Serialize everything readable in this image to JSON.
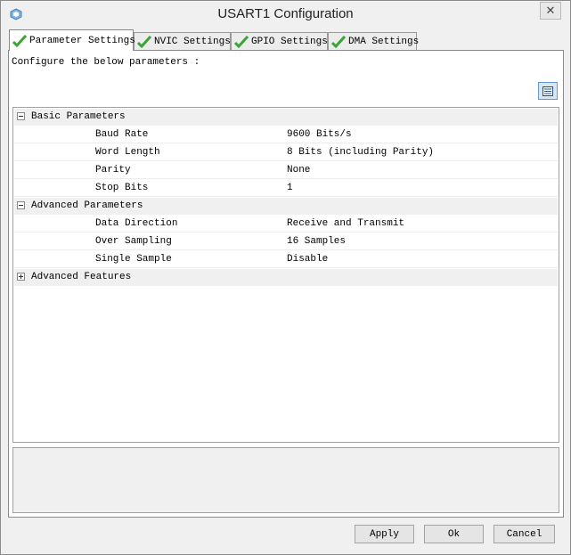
{
  "window": {
    "title": "USART1 Configuration",
    "close_glyph": "✕"
  },
  "tabs": [
    {
      "label": "Parameter Settings",
      "active": true
    },
    {
      "label": "NVIC Settings",
      "active": false
    },
    {
      "label": "GPIO Settings",
      "active": false
    },
    {
      "label": "DMA Settings",
      "active": false
    }
  ],
  "intro": "Configure the below parameters :",
  "groups": [
    {
      "label": "Basic Parameters",
      "expanded": true,
      "items": [
        {
          "name": "Baud Rate",
          "value": "9600 Bits/s"
        },
        {
          "name": "Word Length",
          "value": "8 Bits (including Parity)"
        },
        {
          "name": "Parity",
          "value": "None"
        },
        {
          "name": "Stop Bits",
          "value": "1"
        }
      ]
    },
    {
      "label": "Advanced Parameters",
      "expanded": true,
      "items": [
        {
          "name": "Data Direction",
          "value": "Receive and Transmit"
        },
        {
          "name": "Over Sampling",
          "value": "16 Samples"
        },
        {
          "name": "Single Sample",
          "value": "Disable"
        }
      ]
    },
    {
      "label": "Advanced Features",
      "expanded": false,
      "items": []
    }
  ],
  "buttons": {
    "apply": "Apply",
    "ok": "Ok",
    "cancel": "Cancel"
  },
  "colors": {
    "check": "#3aa535",
    "accent": "#6a95c8"
  }
}
